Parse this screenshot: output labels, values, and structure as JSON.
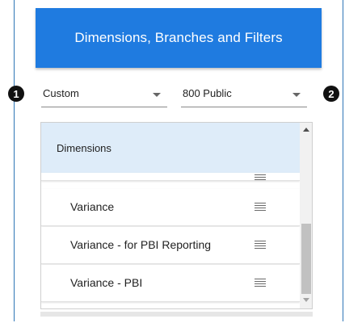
{
  "header": {
    "title": "Dimensions, Branches and Filters"
  },
  "markers": {
    "first": "1",
    "second": "2"
  },
  "dimension_set_select": {
    "value": "Custom",
    "icon": "chevron-down-icon"
  },
  "branch_select": {
    "value": "800 Public",
    "icon": "chevron-down-icon"
  },
  "dimensions_list": {
    "header": "Dimensions",
    "items": [
      {
        "label": "Variance"
      },
      {
        "label": "Variance - for PBI Reporting"
      },
      {
        "label": "Variance - PBI"
      }
    ],
    "item_icon": "drag-handle-icon"
  },
  "colors": {
    "header_bg": "#1f7be0",
    "list_header_bg": "#deecf9",
    "frame_border": "#2e75b6"
  }
}
